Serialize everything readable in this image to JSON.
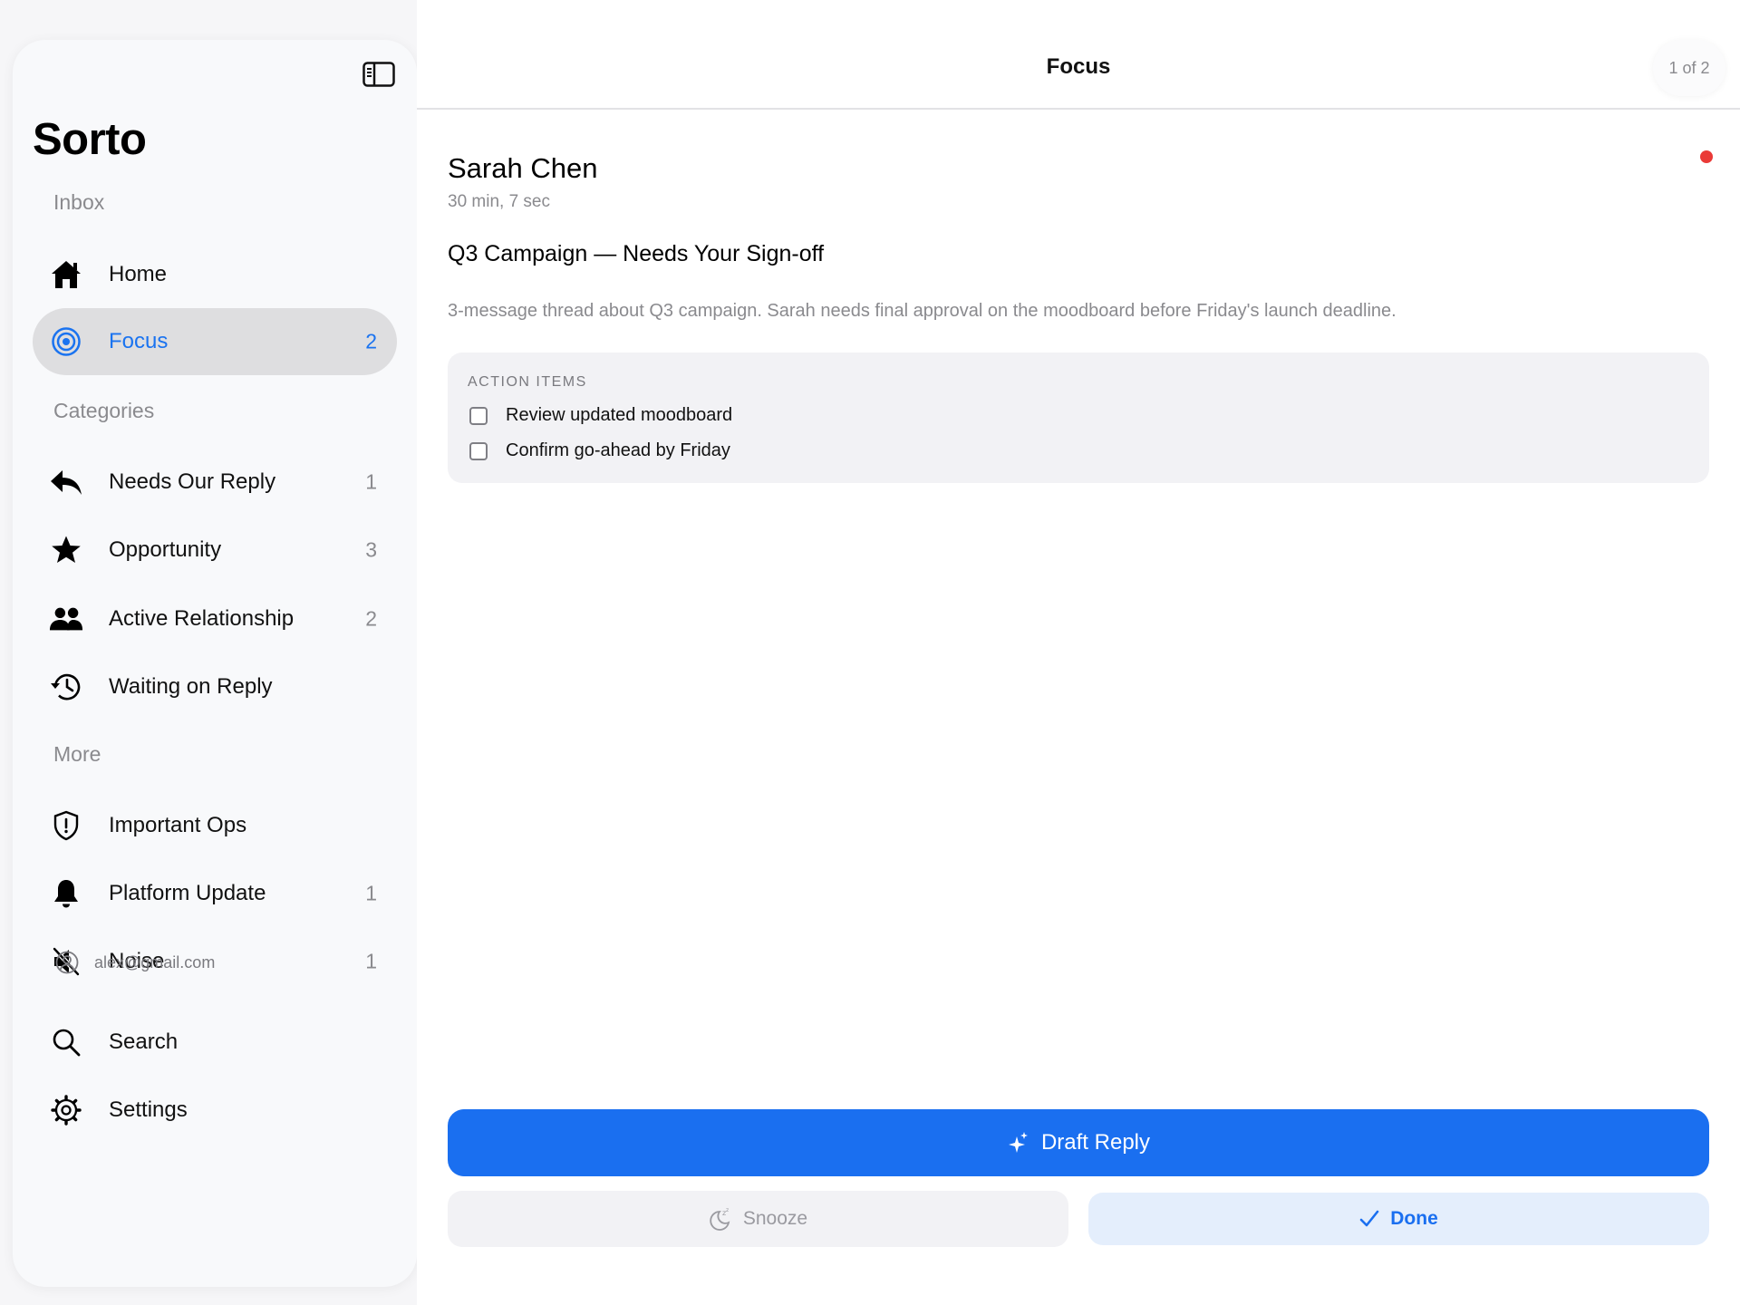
{
  "app": {
    "title": "Sorto"
  },
  "colors": {
    "accent": "#1a6ff0",
    "active_bg": "#dedee0",
    "unread_dot": "#ea3a37"
  },
  "sidebar": {
    "toggle_icon": "sidebar-toggle-icon",
    "sections": {
      "inbox": "Inbox",
      "categories": "Categories",
      "more": "More"
    },
    "items": [
      {
        "label": "Home",
        "count": "",
        "icon": "house-icon"
      },
      {
        "label": "Focus",
        "count": "2",
        "icon": "target-icon",
        "active": true
      },
      {
        "label": "Needs Our Reply",
        "count": "1",
        "icon": "reply-arrow-icon"
      },
      {
        "label": "Opportunity",
        "count": "3",
        "icon": "star-icon"
      },
      {
        "label": "Active Relationship",
        "count": "2",
        "icon": "people-icon"
      },
      {
        "label": "Waiting on Reply",
        "count": "",
        "icon": "history-clock-icon"
      },
      {
        "label": "Important Ops",
        "count": "",
        "icon": "shield-alert-icon"
      },
      {
        "label": "Platform Update",
        "count": "1",
        "icon": "bell-icon"
      },
      {
        "label": "Noise",
        "count": "1",
        "icon": "speaker-muted-icon"
      },
      {
        "label": "Search",
        "count": "",
        "icon": "search-icon"
      },
      {
        "label": "Settings",
        "count": "",
        "icon": "gear-icon"
      }
    ],
    "account": {
      "email": "alex@gmail.com",
      "icon": "person-circle-icon"
    }
  },
  "main": {
    "title": "Focus",
    "pager": "1 of 2",
    "message": {
      "sender": "Sarah Chen",
      "elapsed": "30 min, 7 sec",
      "subject": "Q3 Campaign — Needs Your Sign-off",
      "summary": "3-message thread about Q3 campaign. Sarah needs final approval on the moodboard before Friday's launch deadline."
    },
    "action_items": {
      "heading": "ACTION ITEMS",
      "items": [
        {
          "text": "Review updated moodboard",
          "checked": false
        },
        {
          "text": "Confirm go-ahead by Friday",
          "checked": false
        }
      ]
    },
    "buttons": {
      "draft_reply": "Draft Reply",
      "snooze": "Snooze",
      "done": "Done"
    }
  }
}
